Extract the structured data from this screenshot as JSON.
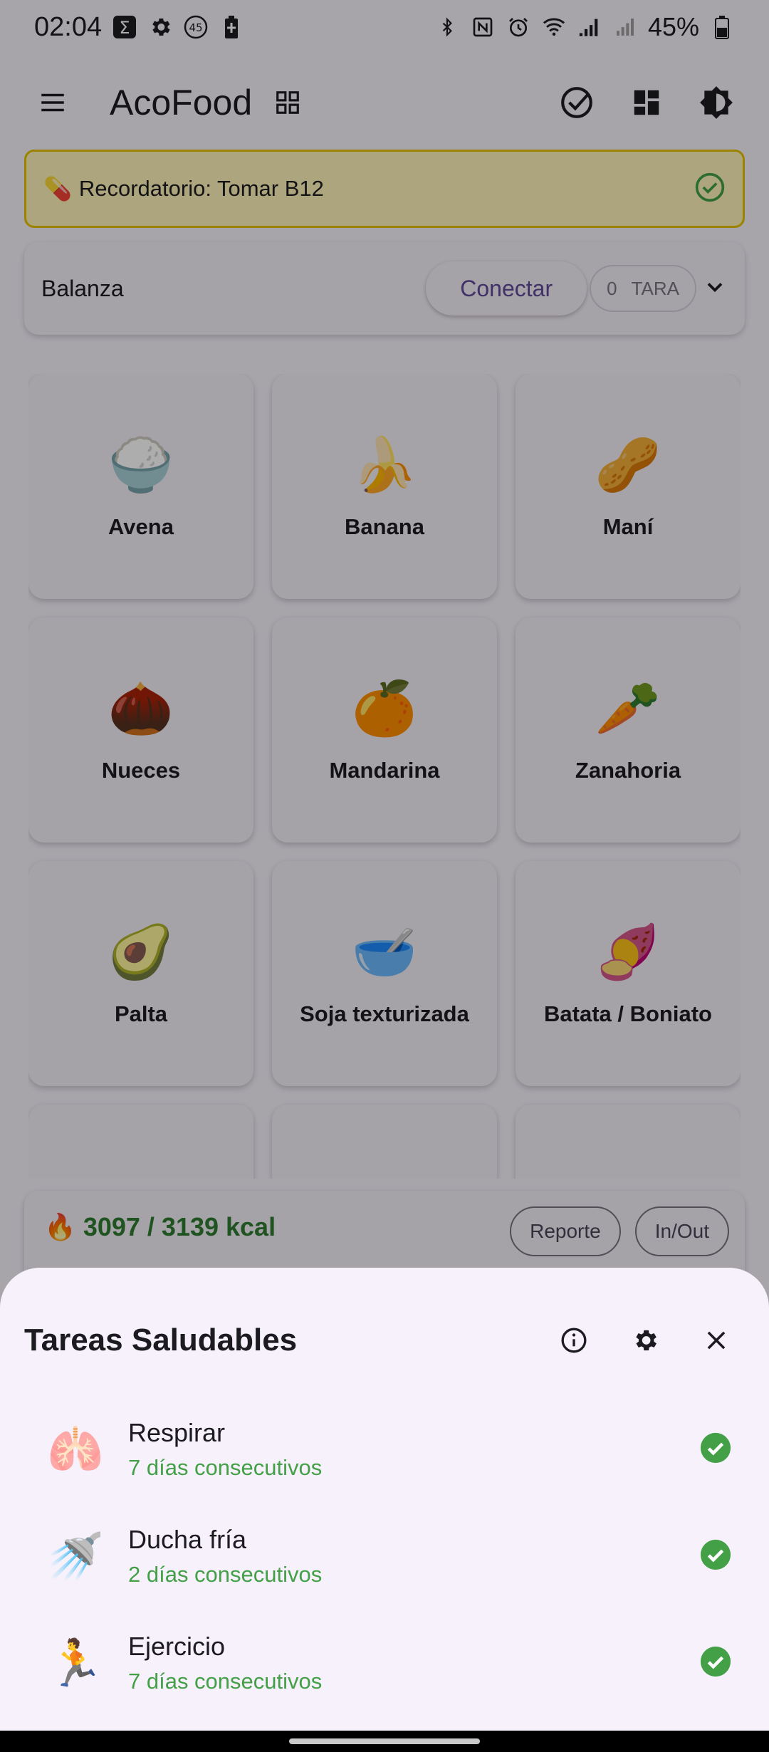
{
  "status_bar": {
    "time": "02:04",
    "notification_count": "45",
    "battery": "45%"
  },
  "app_bar": {
    "title": "AcoFood"
  },
  "reminder": {
    "text": "Recordatorio: Tomar B12",
    "emoji": "💊"
  },
  "scale": {
    "label": "Balanza",
    "connect_label": "Conectar",
    "weight": "0",
    "tara_label": "TARA"
  },
  "foods": [
    {
      "name": "Avena",
      "emoji": "🍚"
    },
    {
      "name": "Banana",
      "emoji": "🍌"
    },
    {
      "name": "Maní",
      "emoji": "🥜"
    },
    {
      "name": "Nueces",
      "emoji": "🌰"
    },
    {
      "name": "Mandarina",
      "emoji": "🍊"
    },
    {
      "name": "Zanahoria",
      "emoji": "🥕"
    },
    {
      "name": "Palta",
      "emoji": "🥑"
    },
    {
      "name": "Soja texturizada",
      "emoji": "🥣"
    },
    {
      "name": "Batata / Boniato",
      "emoji": "🍠"
    },
    {
      "name": "",
      "emoji": ""
    },
    {
      "name": "",
      "emoji": ""
    },
    {
      "name": "",
      "emoji": ""
    }
  ],
  "kcal": {
    "emoji": "🔥",
    "text": "3097 / 3139 kcal",
    "report_label": "Reporte",
    "inout_label": "In/Out"
  },
  "sheet": {
    "title": "Tareas Saludables",
    "tasks": [
      {
        "emoji": "🫁",
        "name": "Respirar",
        "streak": "7 días consecutivos"
      },
      {
        "emoji": "🚿",
        "name": "Ducha fría",
        "streak": "2 días consecutivos"
      },
      {
        "emoji": "🏃",
        "name": "Ejercicio",
        "streak": "7 días consecutivos"
      }
    ]
  },
  "colors": {
    "accent": "#5f4a9a",
    "success": "#43a047",
    "reminder_bg": "#fff4b8",
    "reminder_border": "#e5c200"
  }
}
